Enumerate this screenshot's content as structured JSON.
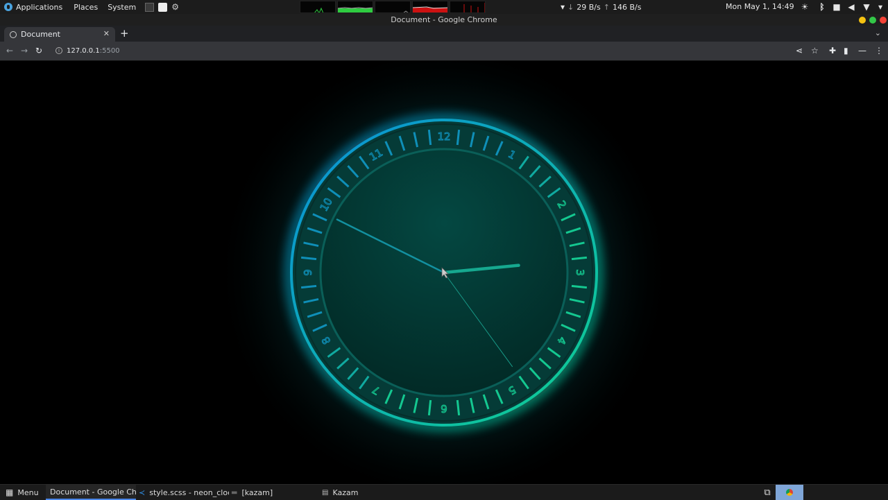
{
  "panel": {
    "applications": "Applications",
    "places": "Places",
    "system": "System",
    "net_down": "29 B/s",
    "net_up": "146 B/s",
    "datetime": "Mon May 1, 14:49"
  },
  "window": {
    "title": "Document - Google Chrome"
  },
  "browser": {
    "tab_title": "Document",
    "url_host": "127.0.0.1",
    "url_port": ":5500"
  },
  "clock": {
    "numbers": [
      "12",
      "1",
      "2",
      "3",
      "4",
      "5",
      "6",
      "7",
      "8",
      "9",
      "10",
      "11"
    ],
    "time": {
      "hour": 2,
      "minute": 49,
      "second": 24
    },
    "colors": {
      "cyan": "#00aaff",
      "green": "#00dd88",
      "face": "#033a33",
      "hand": "#16a08a"
    }
  },
  "taskbar": {
    "menu": "Menu",
    "items": [
      {
        "label": "Document - Google Chr..."
      },
      {
        "label": "style.scss - neon_clock ..."
      },
      {
        "label": "[kazam]"
      },
      {
        "label": "Kazam"
      }
    ]
  }
}
